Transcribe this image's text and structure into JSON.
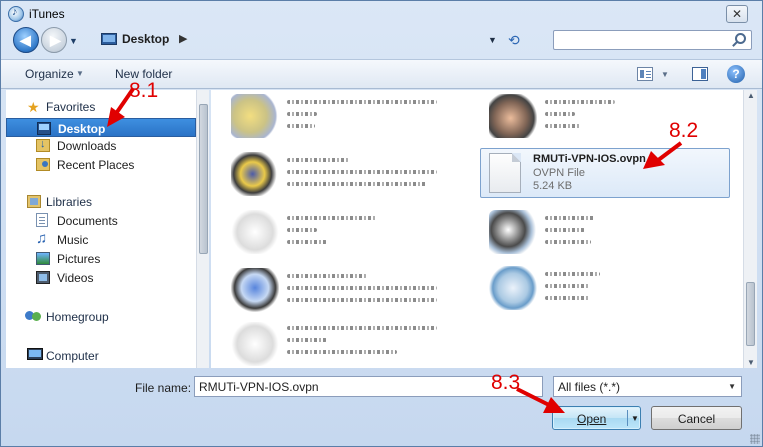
{
  "window": {
    "title": "iTunes",
    "close_label": "✕"
  },
  "nav": {
    "back_glyph": "◀",
    "forward_glyph": "▶",
    "history_glyph": "▼",
    "refresh_glyph": "⟲"
  },
  "address": {
    "location": "Desktop",
    "chevron": "▶",
    "dropdown_glyph": "▼",
    "icon": "desktop-icon"
  },
  "search": {
    "placeholder": "",
    "icon": "search-icon"
  },
  "toolbar": {
    "organize_label": "Organize",
    "organize_caret": "▼",
    "new_folder_label": "New folder",
    "view_caret": "▼",
    "help_label": "?"
  },
  "sidebar": {
    "favorites": {
      "label": "Favorites",
      "icon": "star-icon",
      "items": [
        {
          "label": "Desktop",
          "icon": "desktop-icon",
          "selected": true
        },
        {
          "label": "Downloads",
          "icon": "downloads-icon"
        },
        {
          "label": "Recent Places",
          "icon": "recent-icon"
        }
      ]
    },
    "libraries": {
      "label": "Libraries",
      "icon": "libraries-icon",
      "items": [
        {
          "label": "Documents",
          "icon": "documents-icon"
        },
        {
          "label": "Music",
          "icon": "music-icon"
        },
        {
          "label": "Pictures",
          "icon": "pictures-icon"
        },
        {
          "label": "Videos",
          "icon": "videos-icon"
        }
      ]
    },
    "homegroup": {
      "label": "Homegroup",
      "icon": "homegroup-icon"
    },
    "computer": {
      "label": "Computer",
      "icon": "computer-icon"
    }
  },
  "files": {
    "selected": {
      "name": "RMUTi-VPN-IOS.ovpn",
      "type": "OVPN File",
      "size": "5.24 KB"
    }
  },
  "footer": {
    "file_name_label": "File name:",
    "file_name_value": "RMUTi-VPN-IOS.ovpn",
    "filter_value": "All files (*.*)",
    "filter_caret": "▼",
    "open_label": "Open",
    "open_caret": "▼",
    "cancel_label": "Cancel"
  },
  "annotations": {
    "step1": "8.1",
    "step2": "8.2",
    "step3": "8.3",
    "color": "#e00000"
  },
  "colors": {
    "selection": "#2b73c6",
    "accent": "#3c7fb1"
  }
}
